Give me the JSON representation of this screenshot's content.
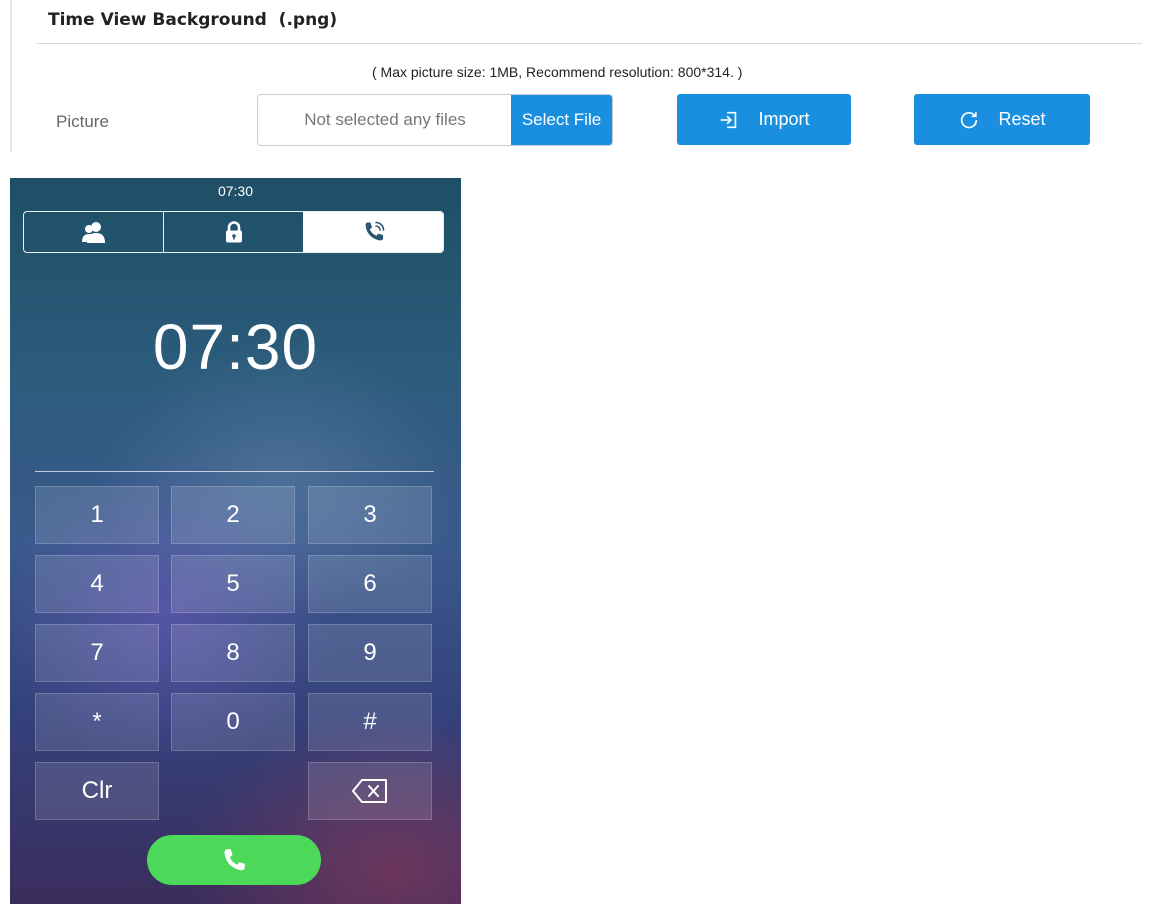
{
  "settings": {
    "section_title": "Time View Background  (.png)",
    "hint": "( Max picture size: 1MB, Recommend resolution: 800*314. )",
    "picture_label": "Picture",
    "file_placeholder": "Not selected any files",
    "select_file_label": "Select File",
    "import_label": "Import",
    "reset_label": "Reset",
    "accent_color": "#1a8fe0"
  },
  "phone": {
    "status_time": "07:30",
    "tabs": [
      {
        "icon": "contacts-icon",
        "active": false
      },
      {
        "icon": "lock-icon",
        "active": false
      },
      {
        "icon": "phone-call-icon",
        "active": true
      }
    ],
    "clock": "07:30",
    "keys": [
      {
        "label": "1"
      },
      {
        "label": "2"
      },
      {
        "label": "3"
      },
      {
        "label": "4"
      },
      {
        "label": "5"
      },
      {
        "label": "6"
      },
      {
        "label": "7"
      },
      {
        "label": "8"
      },
      {
        "label": "9"
      },
      {
        "label": "*"
      },
      {
        "label": "0"
      },
      {
        "label": "#"
      },
      {
        "label": "Clr"
      },
      {
        "icon": "backspace-icon"
      }
    ],
    "call_button_icon": "phone-icon",
    "call_button_color": "#4cd95a"
  }
}
